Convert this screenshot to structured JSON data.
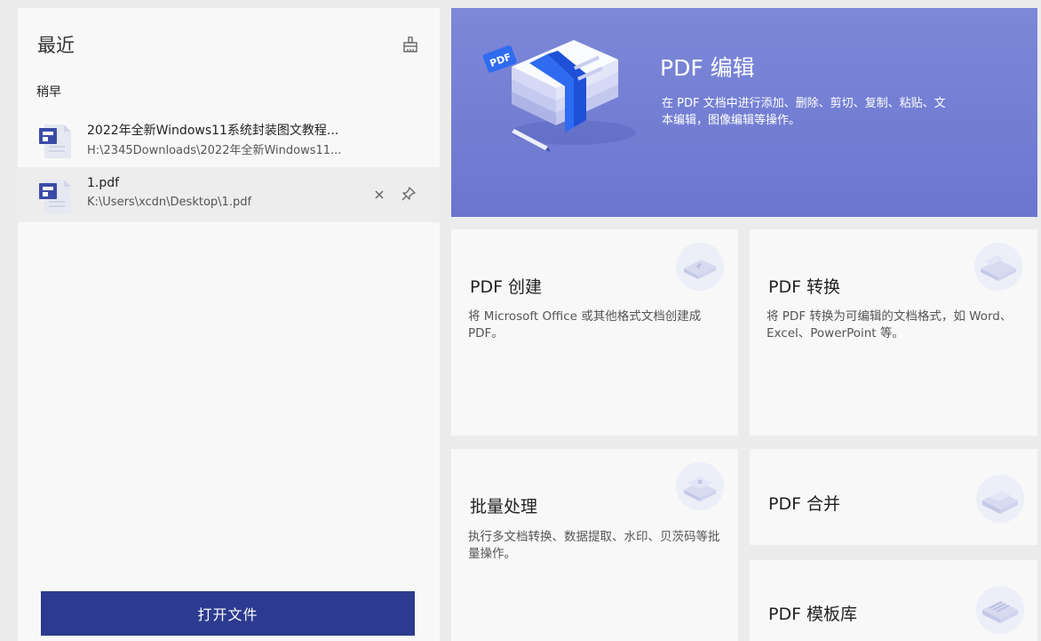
{
  "recent": {
    "title": "最近",
    "section_label": "稍早",
    "files": [
      {
        "name": "2022年全新Windows11系统封装图文教程...",
        "path": "H:\\2345Downloads\\2022年全新Windows11..."
      },
      {
        "name": "1.pdf",
        "path": "K:\\Users\\xcdn\\Desktop\\1.pdf"
      }
    ],
    "open_button": "打开文件"
  },
  "hero": {
    "title": "PDF 编辑",
    "desc": "在 PDF 文档中进行添加、删除、剪切、复制、粘贴、文本编辑，图像编辑等操作。",
    "badge": "PDF"
  },
  "cards": {
    "create": {
      "title": "PDF 创建",
      "desc": "将 Microsoft Office 或其他格式文档创建成 PDF。"
    },
    "convert": {
      "title": "PDF 转换",
      "desc": "将 PDF 转换为可编辑的文档格式，如 Word、Excel、PowerPoint 等。"
    },
    "batch": {
      "title": "批量处理",
      "desc": "执行多文档转换、数据提取、水印、贝茨码等批量操作。"
    },
    "merge": {
      "title": "PDF 合并"
    },
    "template": {
      "title": "PDF 模板库"
    }
  },
  "icons": {
    "clean": "broom-icon",
    "file": "pdf-file-icon",
    "close": "close-icon",
    "pin": "pin-icon"
  },
  "colors": {
    "accent": "#2c3b8f",
    "hero_bg": "#7580d4",
    "file_icon": "#3b4ba6"
  }
}
